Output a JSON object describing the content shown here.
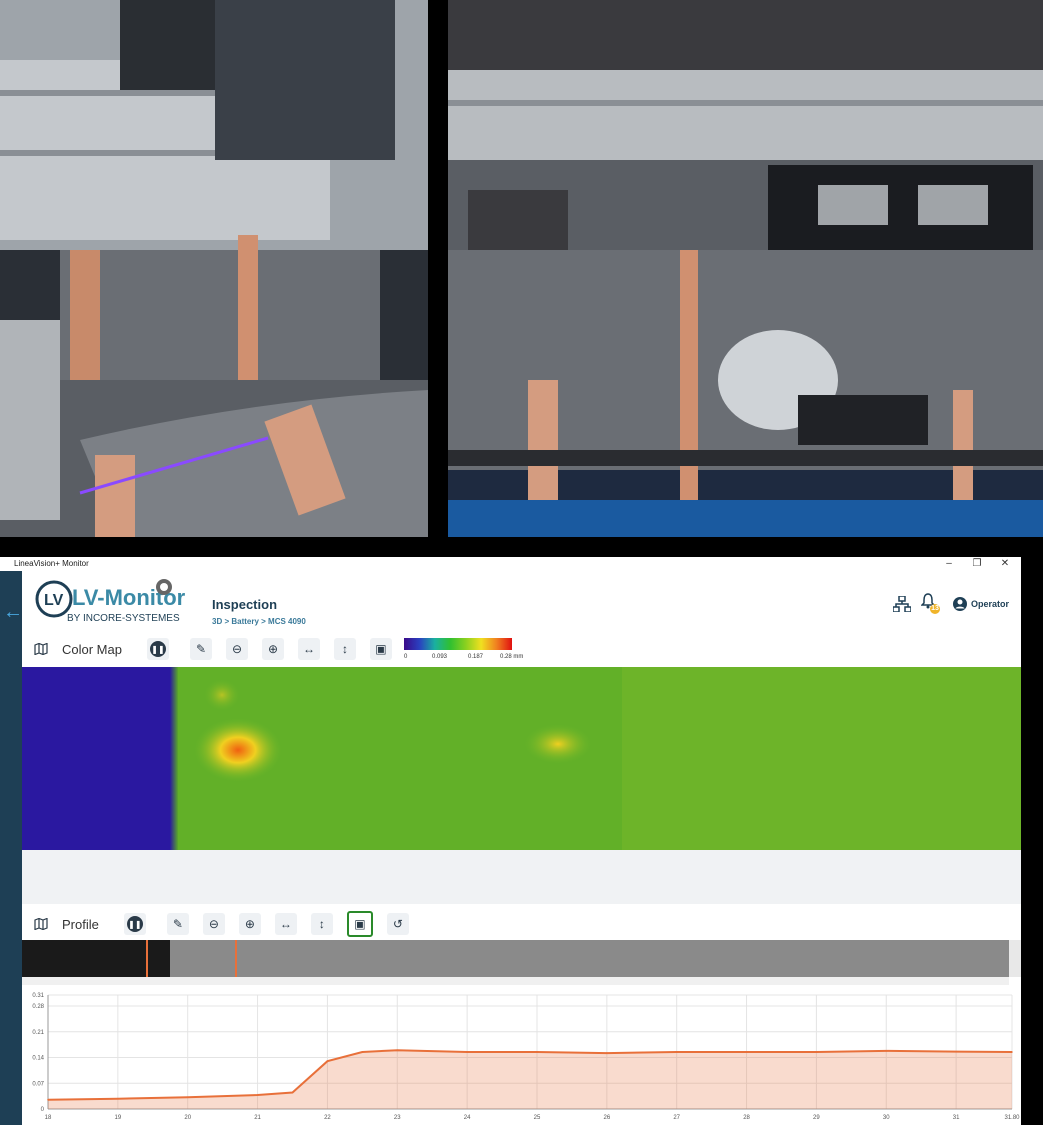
{
  "window": {
    "title": "LineaVision+ Monitor",
    "minimize": "–",
    "maximize": "❐",
    "close": "✕"
  },
  "header": {
    "logo_main": "LV-Monitor",
    "logo_sub": "BY INCORE-SYSTEMES",
    "page_title": "Inspection",
    "breadcrumb": "3D > Battery > MCS 4090",
    "notification_count": "13",
    "user": "Operator",
    "icons": [
      "network-icon",
      "bell-icon",
      "user-icon"
    ]
  },
  "colormap_toolbar": {
    "label": "Color Map",
    "icons": [
      "map-icon",
      "pause-icon",
      "ruler-icon",
      "zoom-out-icon",
      "zoom-in-icon",
      "fit-horizontal-icon",
      "fit-vertical-icon",
      "roi-icon"
    ],
    "legend": {
      "ticks": [
        "0",
        "0.093",
        "0.187",
        "0.28 mm"
      ]
    }
  },
  "profile_toolbar": {
    "label": "Profile",
    "icons": [
      "map-icon",
      "pause-icon",
      "ruler-icon",
      "zoom-out-icon",
      "zoom-in-icon",
      "fit-horizontal-icon",
      "fit-vertical-icon",
      "roi-icon",
      "reset-icon"
    ]
  },
  "colors": {
    "sidebar": "#1e3f55",
    "accent": "#e8703a",
    "active_outline": "#2a8a2a",
    "badge": "#f0b429"
  },
  "chart_data": {
    "type": "area",
    "x": [
      18,
      19,
      20,
      21,
      21.5,
      22,
      22.5,
      23,
      24,
      25,
      26,
      27,
      28,
      29,
      30,
      31,
      31.8
    ],
    "values": [
      0.025,
      0.028,
      0.032,
      0.038,
      0.045,
      0.13,
      0.155,
      0.16,
      0.155,
      0.155,
      0.152,
      0.155,
      0.155,
      0.155,
      0.158,
      0.156,
      0.155
    ],
    "xticks": [
      "18",
      "19",
      "20",
      "21",
      "22",
      "23",
      "24",
      "25",
      "26",
      "27",
      "28",
      "29",
      "30",
      "31",
      "31.80"
    ],
    "yticks": [
      "0",
      "0.07",
      "0.14",
      "0.21",
      "0.28",
      "0.31"
    ],
    "xlim": [
      18,
      31.8
    ],
    "ylim": [
      0,
      0.31
    ],
    "grid": true,
    "color": "#e8703a"
  }
}
